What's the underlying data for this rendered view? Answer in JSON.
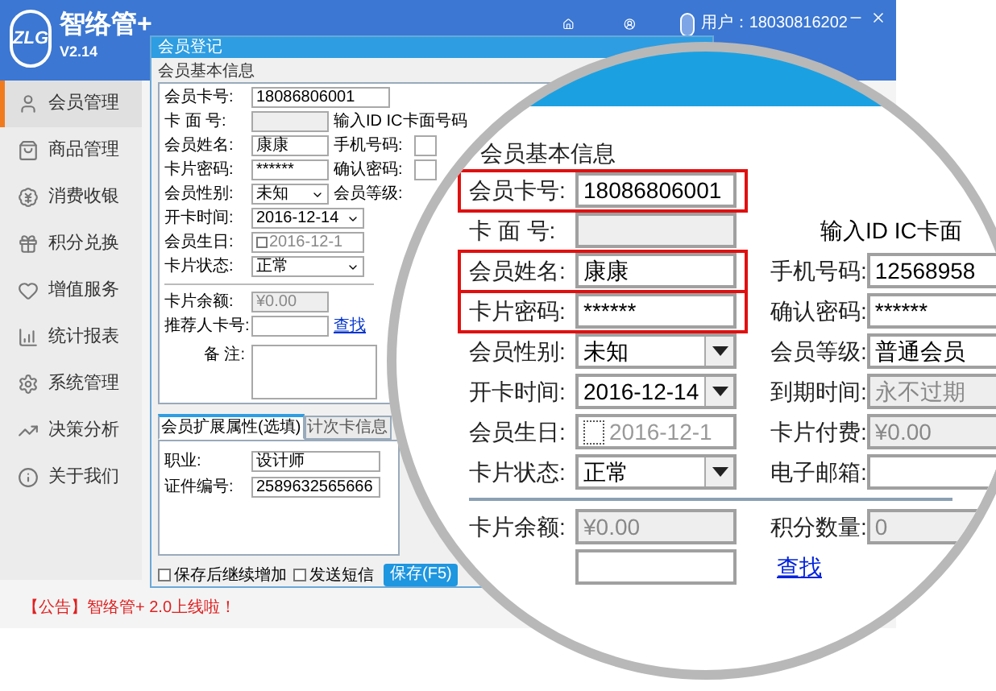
{
  "header": {
    "logo_text": "ZLG",
    "app_name": "智络管+",
    "version": "V2.14",
    "user": "用户：18030816202"
  },
  "sidebar": {
    "items": [
      {
        "label": "会员管理",
        "selected": true
      },
      {
        "label": "商品管理",
        "selected": false
      },
      {
        "label": "消费收银",
        "selected": false
      },
      {
        "label": "积分兑换",
        "selected": false
      },
      {
        "label": "增值服务",
        "selected": false
      },
      {
        "label": "统计报表",
        "selected": false
      },
      {
        "label": "系统管理",
        "selected": false
      },
      {
        "label": "决策分析",
        "selected": false
      },
      {
        "label": "关于我们",
        "selected": false
      }
    ]
  },
  "notice": "【公告】智络管+ 2.0上线啦！",
  "dialog": {
    "title": "会员登记",
    "section": "会员基本信息",
    "rows": [
      {
        "label": "会员卡号:",
        "kind": "text",
        "value": "18086806001"
      },
      {
        "label": "卡 面 号:",
        "kind": "readonly",
        "right": {
          "kind": "hint",
          "label": "输入ID IC卡面号码"
        }
      },
      {
        "label": "会员姓名:",
        "kind": "text",
        "value": "康康",
        "right": {
          "kind": "field",
          "label": "手机号码:"
        }
      },
      {
        "label": "卡片密码:",
        "kind": "text",
        "value": "******",
        "right": {
          "kind": "field",
          "label": "确认密码:"
        }
      },
      {
        "label": "会员性别:",
        "kind": "select",
        "value": "未知",
        "right": {
          "kind": "label",
          "label": "会员等级:"
        }
      },
      {
        "label": "开卡时间:",
        "kind": "select",
        "value": "2016-12-14"
      },
      {
        "label": "会员生日:",
        "kind": "date",
        "value": "2016-12-1",
        "checked": false
      },
      {
        "label": "卡片状态:",
        "kind": "select",
        "value": "正常"
      },
      {
        "label": "卡片余额:",
        "kind": "readonly",
        "value": "¥0.00",
        "divider": true
      },
      {
        "label": "推荐人卡号:",
        "kind": "text",
        "right": {
          "kind": "link",
          "label": "查找"
        }
      }
    ],
    "remark_label": "备 注:",
    "tabs": [
      {
        "label": "会员扩展属性(选填)",
        "selected": true
      },
      {
        "label": "计次卡信息",
        "selected": false
      }
    ],
    "extra_fields": [
      {
        "label": "职业:",
        "value": "设计师"
      },
      {
        "label": "证件编号:",
        "value": "2589632565666"
      }
    ],
    "checkboxes": [
      {
        "label": "保存后继续增加",
        "checked": false
      },
      {
        "label": "发送短信",
        "checked": false
      }
    ],
    "save_button": "保存(F5)"
  },
  "magnifier": {
    "section": "会员基本信息",
    "rows": [
      {
        "label": "会员卡号:",
        "kind": "text",
        "value": "18086806001",
        "highlighted": true
      },
      {
        "label": "卡 面 号:",
        "kind": "readonly",
        "highlighted": false,
        "right": {
          "kind": "hint",
          "label": "输入ID IC卡面"
        }
      },
      {
        "label": "会员姓名:",
        "kind": "text",
        "value": "康康",
        "highlighted": true,
        "right": {
          "kind": "text",
          "label": "手机号码:",
          "value": "12568958"
        }
      },
      {
        "label": "卡片密码:",
        "kind": "text",
        "value": "******",
        "highlighted": true,
        "right": {
          "kind": "text",
          "label": "确认密码:",
          "value": "******"
        }
      },
      {
        "label": "会员性别:",
        "kind": "select",
        "value": "未知",
        "highlighted": false,
        "right": {
          "kind": "text",
          "label": "会员等级:",
          "value": "普通会员"
        }
      },
      {
        "label": "开卡时间:",
        "kind": "select",
        "value": "2016-12-14",
        "highlighted": false,
        "right": {
          "kind": "readonly",
          "label": "到期时间:",
          "value": "永不过期"
        }
      },
      {
        "label": "会员生日:",
        "kind": "date",
        "value": "2016-12-1",
        "checked": false,
        "highlighted": false,
        "right": {
          "kind": "readonly",
          "label": "卡片付费:",
          "value": "¥0.00"
        }
      },
      {
        "label": "卡片状态:",
        "kind": "select",
        "value": "正常",
        "highlighted": false,
        "right": {
          "kind": "text",
          "label": "电子邮箱:"
        }
      },
      {
        "label": "卡片余额:",
        "kind": "readonly",
        "value": "¥0.00",
        "highlighted": false,
        "divider": true,
        "right": {
          "kind": "readonly",
          "label": "积分数量:",
          "value": "0"
        }
      },
      {
        "kind": "text",
        "highlighted": false,
        "right": {
          "kind": "link",
          "label": "查找"
        }
      }
    ]
  }
}
